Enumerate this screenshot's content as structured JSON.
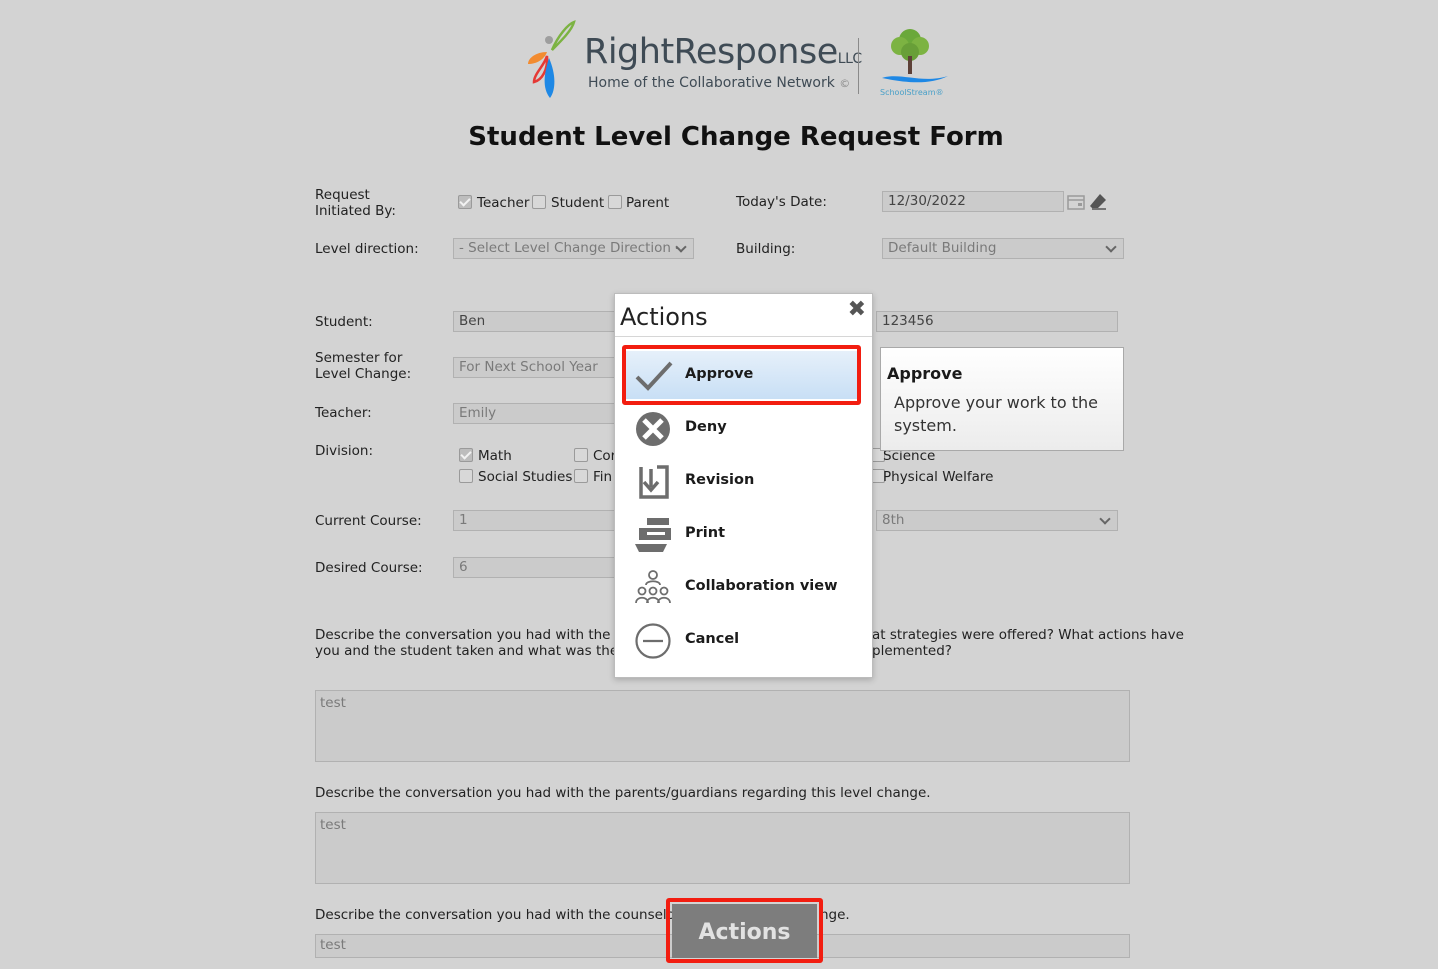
{
  "header": {
    "brand_name": "RightResponse",
    "brand_suffix": "LLC",
    "brand_tagline": "Home of the Collaborative Network",
    "brand_registered": "©",
    "partner_name": "SchoolStream",
    "partner_mark": "®"
  },
  "form": {
    "title": "Student Level Change Request Form",
    "request_initiated_by_label_line1": "Request",
    "request_initiated_by_label_line2": "Initiated By:",
    "initiators": [
      {
        "label": "Teacher",
        "checked": true
      },
      {
        "label": "Student",
        "checked": false
      },
      {
        "label": "Parent",
        "checked": false
      }
    ],
    "todays_date_label": "Today's Date:",
    "todays_date_value": "12/30/2022",
    "level_direction_label": "Level direction:",
    "level_direction_value": "- Select Level Change Direction -",
    "building_label": "Building:",
    "building_value": "Default Building",
    "student_label": "Student:",
    "student_value": "Ben",
    "student_id_value": "123456",
    "semester_label_line1": "Semester for",
    "semester_label_line2": "Level Change:",
    "semester_value": "For Next School Year",
    "teacher_label": "Teacher:",
    "teacher_value": "Emily",
    "division_label": "Division:",
    "divisions_visible": [
      {
        "label": "Math",
        "checked": true
      },
      {
        "label": "Cor",
        "checked": false
      },
      {
        "label": "Science",
        "checked": false
      },
      {
        "label": "Social Studies",
        "checked": false
      },
      {
        "label": "Fin",
        "checked": false
      },
      {
        "label": "Physical Welfare",
        "checked": false
      }
    ],
    "current_course_label": "Current Course:",
    "current_course_value": "1",
    "grade_value": "8th",
    "desired_course_label": "Desired Course:",
    "desired_course_value": "6",
    "q1_left_line1": "Describe the conversation you had with the st",
    "q1_left_line2": "you and the student taken and what was the f",
    "q1_right_line1": "at strategies were offered? What actions have",
    "q1_right_line2": "plemented?",
    "q1_answer": "test",
    "q2_text": "Describe the conversation you had with the parents/guardians regarding this level change.",
    "q2_answer": "test",
    "q3_left": "Describe the conversation you had with the counselor",
    "q3_right": "nge.",
    "q3_answer": "test"
  },
  "actions_popup": {
    "title": "Actions",
    "close_glyph": "✖",
    "items": [
      {
        "label": "Approve",
        "icon": "checkmark-icon"
      },
      {
        "label": "Deny",
        "icon": "deny-icon"
      },
      {
        "label": "Revision",
        "icon": "revision-icon"
      },
      {
        "label": "Print",
        "icon": "printer-icon"
      },
      {
        "label": "Collaboration view",
        "icon": "collaboration-icon"
      },
      {
        "label": "Cancel",
        "icon": "cancel-icon"
      }
    ]
  },
  "tooltip": {
    "title": "Approve",
    "body": "Approve your work to the system."
  },
  "actions_button": {
    "label": "Actions"
  },
  "colors": {
    "highlight": "#f21d10",
    "page_bg": "#d3d3d3",
    "actions_button_bg": "#7d7d7d"
  }
}
